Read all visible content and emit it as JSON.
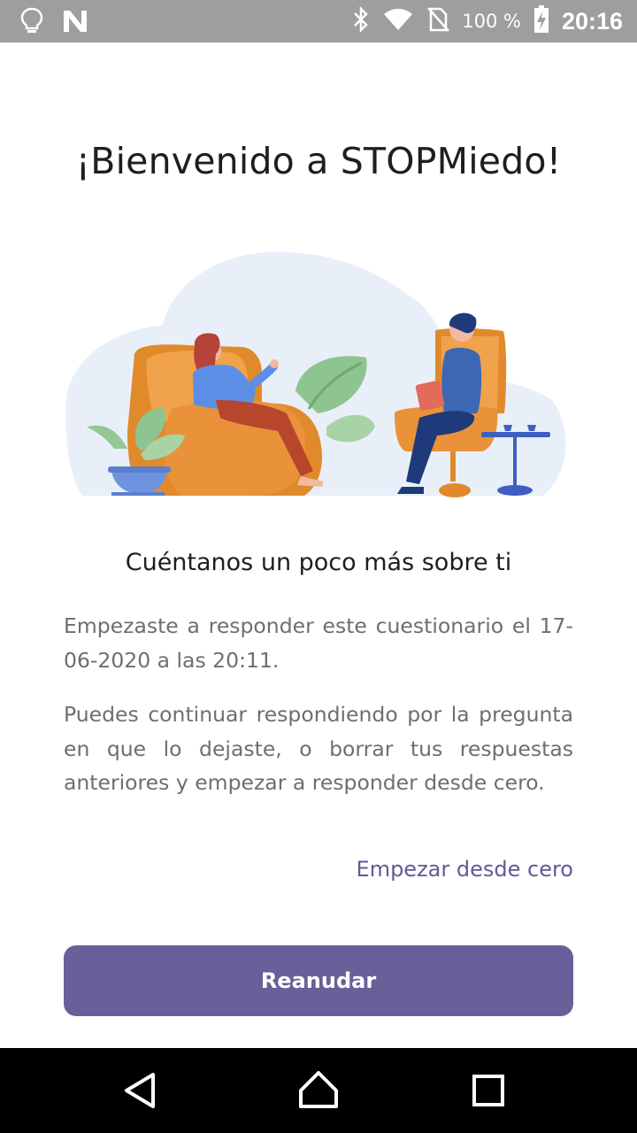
{
  "status_bar": {
    "icons_left": [
      "lightbulb-icon",
      "n-logo-icon"
    ],
    "icons_right": [
      "bluetooth-icon",
      "wifi-icon",
      "no-sim-icon",
      "battery-charging-icon"
    ],
    "battery_text": "100 %",
    "time": "20:16"
  },
  "main": {
    "title": "¡Bienvenido a STOPMiedo!",
    "subtitle": "Cuéntanos un poco más sobre ti",
    "paragraph_1": "Empezaste a responder este cuestionario el 17-06-2020 a las 20:11.",
    "paragraph_2": "Puedes continuar respondiendo por la pregunta en que lo dejaste, o borrar tus respuestas anteriores y empezar a responder desde cero.",
    "restart_link": "Empezar desde cero",
    "resume_button": "Reanudar"
  },
  "nav_bar": {
    "buttons": [
      "back-icon",
      "home-icon",
      "recents-icon"
    ]
  },
  "colors": {
    "accent": "#6a5f99",
    "link": "#65589a",
    "status_bar": "#9e9e9e",
    "body_text": "#6e6e6e",
    "heading": "#1e1e1e"
  }
}
